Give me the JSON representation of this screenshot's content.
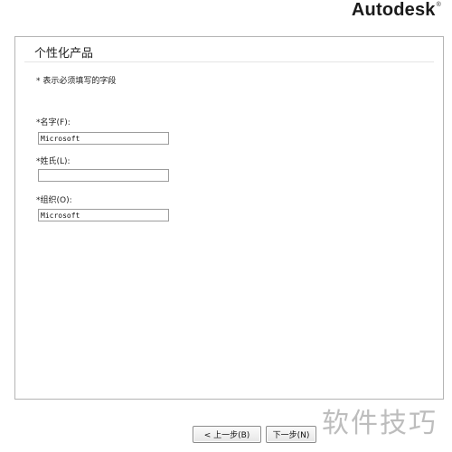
{
  "header": {
    "brand": "Autodesk",
    "brand_mark": "®"
  },
  "form": {
    "title": "个性化产品",
    "required_note": "* 表示必须填写的字段",
    "first_name": {
      "label": "*名字(F):",
      "value": "Microsoft"
    },
    "last_name": {
      "label": "*姓氏(L):",
      "value": ""
    },
    "organization": {
      "label": "*组织(O):",
      "value": "Microsoft"
    }
  },
  "nav": {
    "back_label": "< 上一步(B)",
    "next_label": "下一步(N)"
  },
  "watermark": "软件技巧"
}
